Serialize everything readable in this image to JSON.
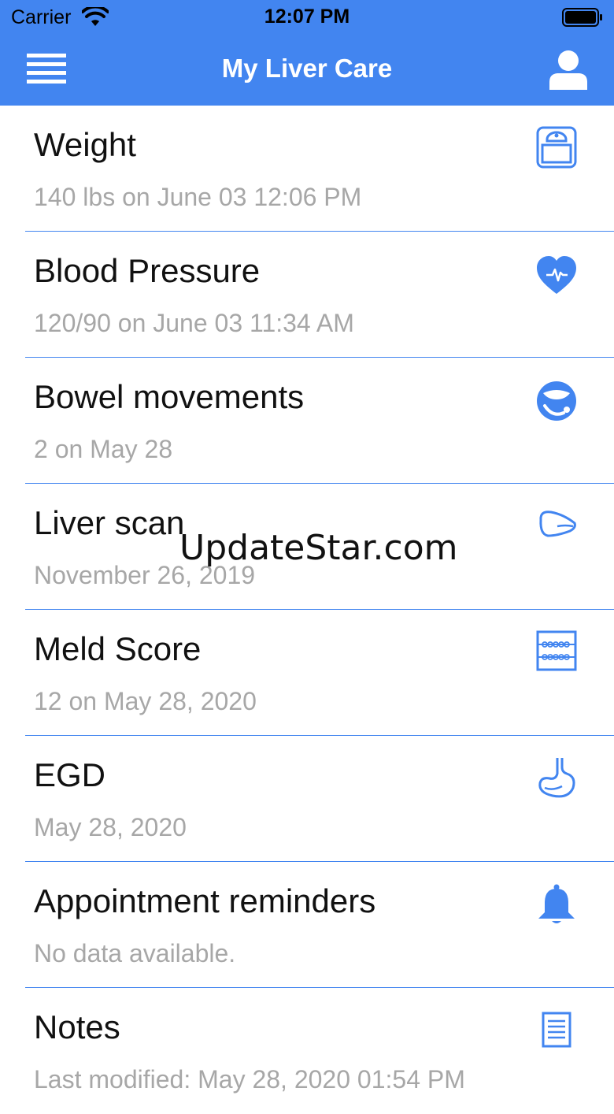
{
  "status_bar": {
    "carrier": "Carrier",
    "time": "12:07 PM"
  },
  "nav": {
    "title": "My Liver Care",
    "menu_icon": "hamburger-menu-icon",
    "profile_icon": "user-profile-icon"
  },
  "colors": {
    "primary": "#4285f0",
    "subtitle": "#a7a7a7",
    "title": "#111111"
  },
  "items": [
    {
      "title": "Weight",
      "subtitle": "140 lbs on June 03  12:06 PM",
      "icon": "scale-icon"
    },
    {
      "title": "Blood Pressure",
      "subtitle": "120/90 on June 03 11:34 AM",
      "icon": "heart-pulse-icon"
    },
    {
      "title": "Bowel movements",
      "subtitle": "2 on May 28",
      "icon": "bowel-icon"
    },
    {
      "title": "Liver scan",
      "subtitle": "November 26, 2019",
      "icon": "liver-icon"
    },
    {
      "title": "Meld Score",
      "subtitle": "12 on May 28, 2020",
      "icon": "abacus-icon"
    },
    {
      "title": "EGD",
      "subtitle": "May 28, 2020",
      "icon": "stomach-icon"
    },
    {
      "title": "Appointment reminders",
      "subtitle": "No data available.",
      "icon": "bell-icon"
    },
    {
      "title": "Notes",
      "subtitle": "Last modified: May 28, 2020 01:54 PM",
      "icon": "notes-icon"
    }
  ],
  "watermark": "UpdateStar.com"
}
